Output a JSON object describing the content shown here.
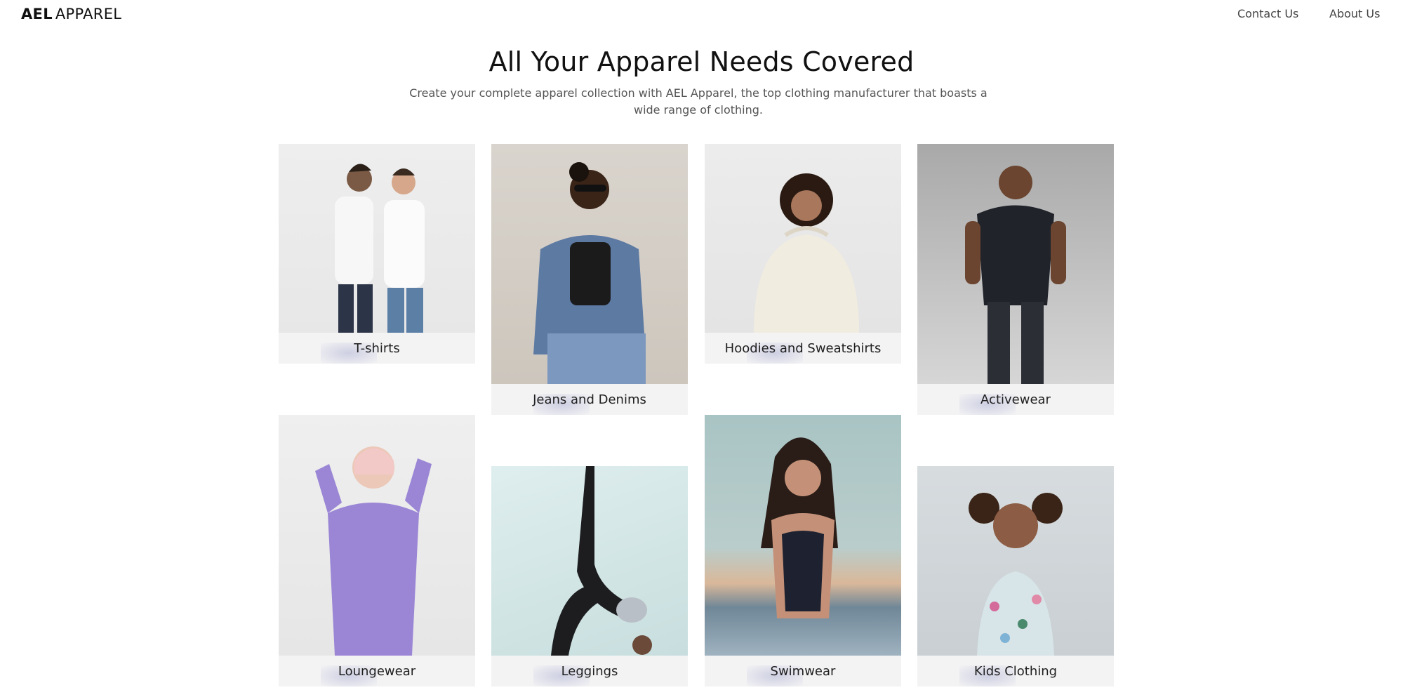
{
  "brand": {
    "logo_bold": "AEL",
    "logo_light": "APPAREL"
  },
  "nav": {
    "links": [
      {
        "label": "Contact Us"
      },
      {
        "label": "About Us"
      }
    ]
  },
  "hero": {
    "title": "All Your Apparel Needs Covered",
    "subtitle": "Create your complete apparel collection with AEL Apparel, the top clothing manufacturer that boasts a wide range of clothing."
  },
  "categories": [
    {
      "label": "T-shirts"
    },
    {
      "label": "Jeans and Denims"
    },
    {
      "label": "Hoodies and Sweatshirts"
    },
    {
      "label": "Activewear"
    },
    {
      "label": "Loungewear"
    },
    {
      "label": "Leggings"
    },
    {
      "label": "Swimwear"
    },
    {
      "label": "Kids Clothing"
    }
  ],
  "colors": {
    "label_bg": "#f3f3f4",
    "text": "#1d1d1d",
    "subtext": "#555555"
  }
}
